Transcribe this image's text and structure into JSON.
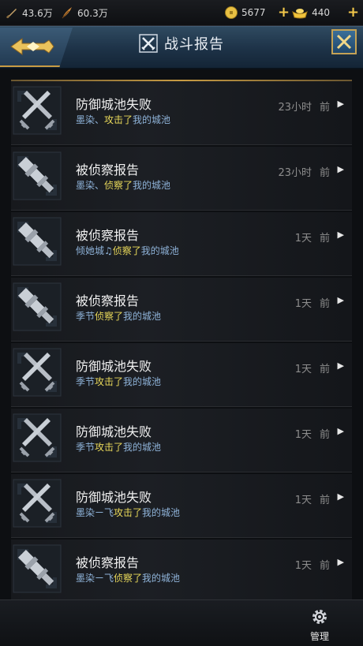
{
  "resources": {
    "power": "43.6万",
    "attack": "60.3万",
    "gold": "5677",
    "ingot": "440"
  },
  "header": {
    "title": "战斗报告"
  },
  "reports": [
    {
      "type": "defense-fail",
      "title": "防御城池失败",
      "actor": "墨染、",
      "action": "攻击了",
      "target": "我的城池",
      "time_value": "23小时",
      "time_suffix": "前"
    },
    {
      "type": "scout",
      "title": "被侦察报告",
      "actor": "墨染、",
      "action": "侦察了",
      "target": "我的城池",
      "time_value": "23小时",
      "time_suffix": "前"
    },
    {
      "type": "scout",
      "title": "被侦察报告",
      "actor": "倾她城♫",
      "action": "侦察了",
      "target": "我的城池",
      "time_value": "1天",
      "time_suffix": "前"
    },
    {
      "type": "scout",
      "title": "被侦察报告",
      "actor": "季节",
      "action": "侦察了",
      "target": "我的城池",
      "time_value": "1天",
      "time_suffix": "前"
    },
    {
      "type": "defense-fail",
      "title": "防御城池失败",
      "actor": "季节",
      "action": "攻击了",
      "target": "我的城池",
      "time_value": "1天",
      "time_suffix": "前"
    },
    {
      "type": "defense-fail",
      "title": "防御城池失败",
      "actor": "季节",
      "action": "攻击了",
      "target": "我的城池",
      "time_value": "1天",
      "time_suffix": "前"
    },
    {
      "type": "defense-fail",
      "title": "防御城池失败",
      "actor": "墨染ㄧ飞",
      "action": "攻击了",
      "target": "我的城池",
      "time_value": "1天",
      "time_suffix": "前"
    },
    {
      "type": "scout",
      "title": "被侦察报告",
      "actor": "墨染ㄧ飞",
      "action": "侦察了",
      "target": "我的城池",
      "time_value": "1天",
      "time_suffix": "前"
    }
  ],
  "bottom": {
    "manage_label": "管理"
  },
  "colors": {
    "accent_gold": "#c79b43",
    "action_yellow": "#e9d95a",
    "actor_blue": "#8fb3d9"
  }
}
